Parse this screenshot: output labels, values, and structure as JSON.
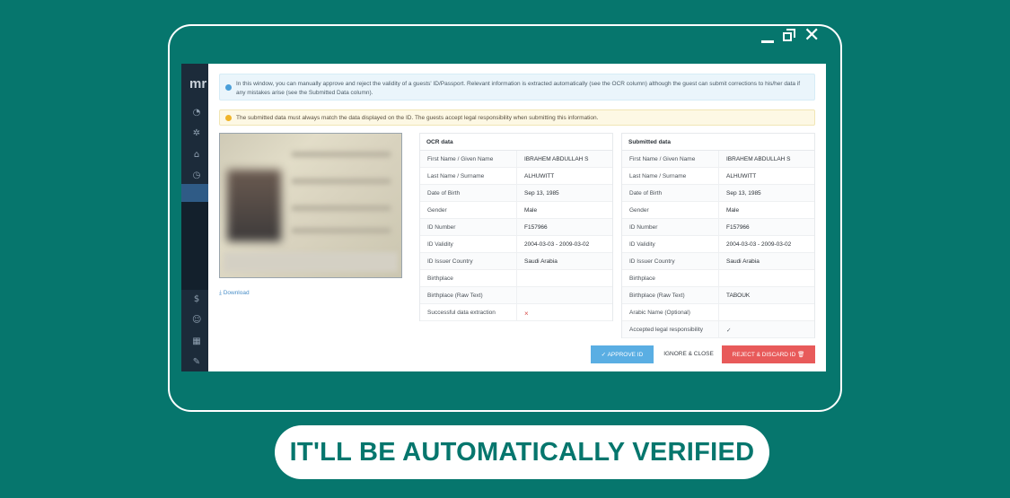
{
  "window_controls": {
    "minimize": "—",
    "maximize": "❐",
    "close": "✕"
  },
  "nav": {
    "logo": "mr",
    "icons": [
      "dashboard-icon",
      "gear-icon",
      "home-icon",
      "clock-icon",
      "dollar-icon",
      "user-icon",
      "grid-icon",
      "tool-icon"
    ]
  },
  "alerts": {
    "info": "In this window, you can manually approve and reject the validity of a guests' ID/Passport. Relevant information is extracted automatically (see the OCR column) although the guest can submit corrections to his/her data if any mistakes arise (see the Submitted Data column).",
    "warning": "The submitted data must always match the data displayed on the ID. The guests accept legal responsibility when submitting this information."
  },
  "download_label": "Download",
  "ocr": {
    "title": "OCR data",
    "rows": [
      {
        "label": "First Name / Given Name",
        "value": "IBRAHEM ABDULLAH S"
      },
      {
        "label": "Last Name / Surname",
        "value": "ALHUWITT"
      },
      {
        "label": "Date of Birth",
        "value": "Sep 13, 1985"
      },
      {
        "label": "Gender",
        "value": "Male"
      },
      {
        "label": "ID Number",
        "value": "F157966"
      },
      {
        "label": "ID Validity",
        "value": "2004-03-03 - 2009-03-02"
      },
      {
        "label": "ID Issuer Country",
        "value": "Saudi Arabia"
      },
      {
        "label": "Birthplace",
        "value": ""
      },
      {
        "label": "Birthplace (Raw Text)",
        "value": ""
      },
      {
        "label": "Successful data extraction",
        "value": "×"
      }
    ]
  },
  "submitted": {
    "title": "Submitted data",
    "rows": [
      {
        "label": "First Name / Given Name",
        "value": "IBRAHEM ABDULLAH S"
      },
      {
        "label": "Last Name / Surname",
        "value": "ALHUWITT"
      },
      {
        "label": "Date of Birth",
        "value": "Sep 13, 1985"
      },
      {
        "label": "Gender",
        "value": "Male"
      },
      {
        "label": "ID Number",
        "value": "F157966"
      },
      {
        "label": "ID Validity",
        "value": "2004-03-03 - 2009-03-02"
      },
      {
        "label": "ID Issuer Country",
        "value": "Saudi Arabia"
      },
      {
        "label": "Birthplace",
        "value": ""
      },
      {
        "label": "Birthplace (Raw Text)",
        "value": "TABOUK"
      },
      {
        "label": "Arabic Name (Optional)",
        "value": ""
      },
      {
        "label": "Accepted legal responsibility",
        "value": "✓"
      }
    ]
  },
  "buttons": {
    "approve": "✓ APPROVE ID",
    "ignore": "IGNORE & CLOSE",
    "reject": "REJECT & DISCARD ID 🗑"
  },
  "banner": "IT'LL BE AUTOMATICALLY VERIFIED",
  "colors": {
    "background": "#06766d",
    "approve": "#5aaee3",
    "reject": "#e85a5a"
  }
}
